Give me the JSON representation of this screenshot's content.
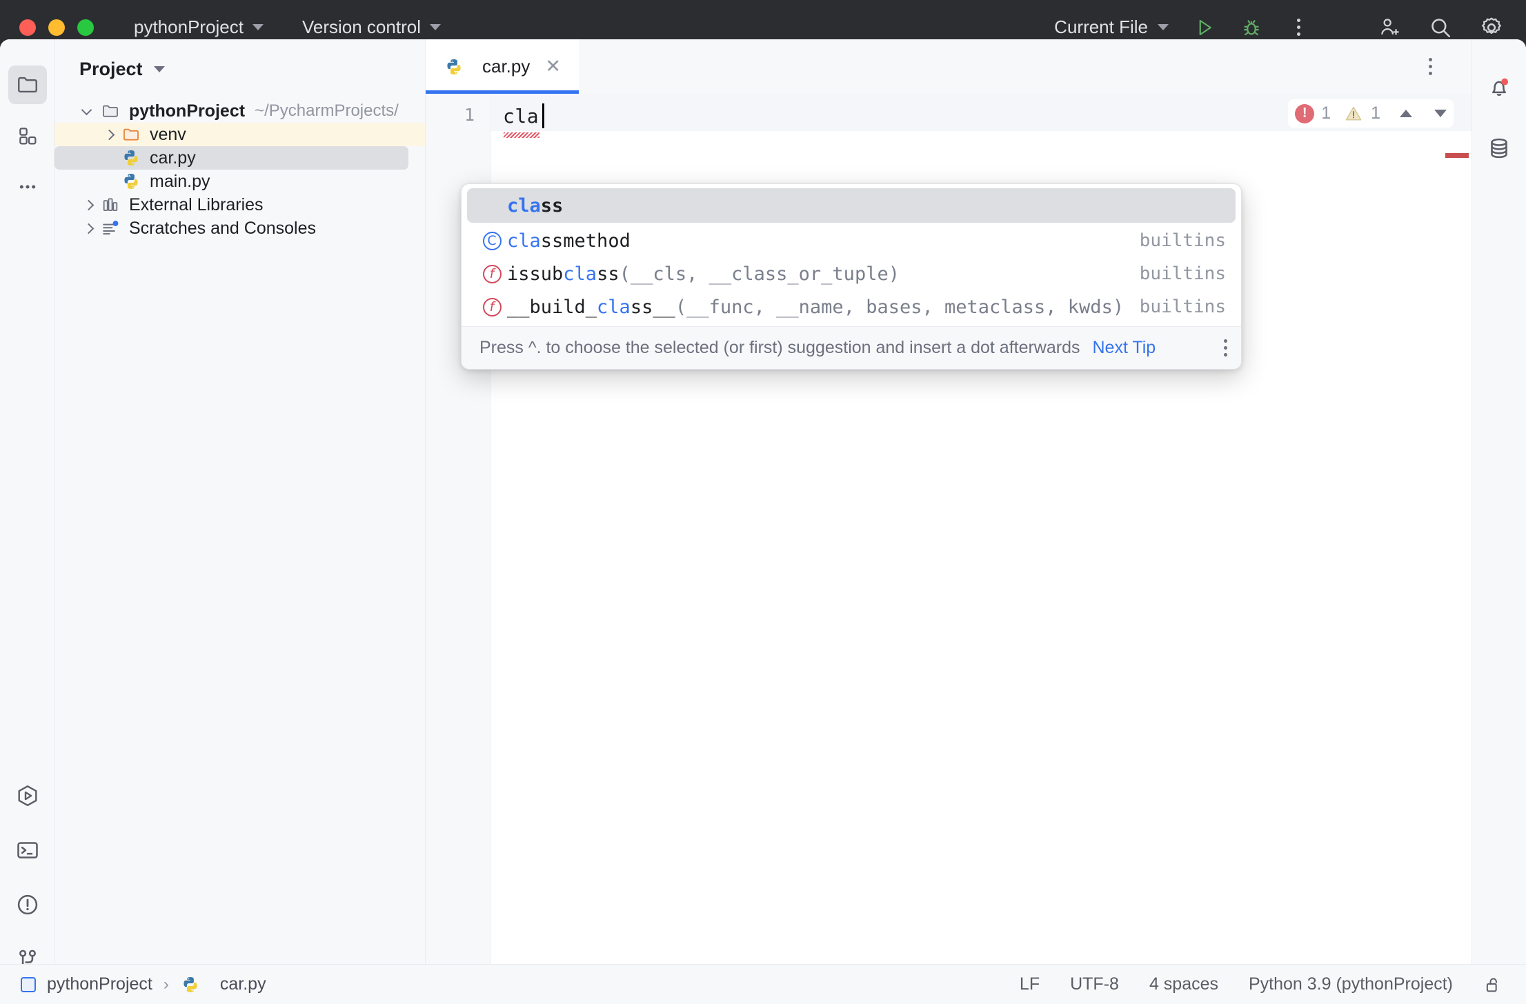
{
  "titlebar": {
    "project_name": "pythonProject",
    "version_control": "Version control",
    "run_config": "Current File",
    "run_icon": "run-triangle-icon",
    "debug_icon": "debug-bug-icon",
    "more_icon": "more-vertical-icon",
    "account_icon": "add-user-icon",
    "search_icon": "search-icon",
    "settings_icon": "gear-icon"
  },
  "left_rail": {
    "top": [
      {
        "name": "project-tool-icon",
        "label": "Project",
        "active": true
      },
      {
        "name": "structure-tool-icon",
        "label": "Structure",
        "active": false
      },
      {
        "name": "more-tools-icon",
        "label": "More tools",
        "active": false
      }
    ],
    "bottom": [
      {
        "name": "run-tool-icon",
        "label": "Run"
      },
      {
        "name": "terminal-tool-icon",
        "label": "Terminal"
      },
      {
        "name": "problems-tool-icon",
        "label": "Problems"
      },
      {
        "name": "version-control-tool-icon",
        "label": "Version Control"
      }
    ]
  },
  "right_rail": {
    "items": [
      {
        "name": "notifications-bell-icon",
        "label": "Notifications",
        "badge": true
      },
      {
        "name": "database-icon",
        "label": "Database",
        "badge": false
      }
    ]
  },
  "project_panel": {
    "title": "Project",
    "tree": [
      {
        "label": "pythonProject",
        "path": "~/PycharmProjects/",
        "icon": "folder-icon",
        "arrow": "down",
        "indent": 1,
        "bold": true,
        "state": "none"
      },
      {
        "label": "venv",
        "path": "",
        "icon": "folder-orange-icon",
        "arrow": "right",
        "indent": 2,
        "bold": false,
        "state": "highlight"
      },
      {
        "label": "car.py",
        "path": "",
        "icon": "python-file-icon",
        "arrow": "none",
        "indent": 3,
        "bold": false,
        "state": "selected"
      },
      {
        "label": "main.py",
        "path": "",
        "icon": "python-file-icon",
        "arrow": "none",
        "indent": 3,
        "bold": false,
        "state": "none"
      },
      {
        "label": "External Libraries",
        "path": "",
        "icon": "library-icon",
        "arrow": "right",
        "indent": 1,
        "bold": false,
        "state": "none"
      },
      {
        "label": "Scratches and Consoles",
        "path": "",
        "icon": "scratches-icon",
        "arrow": "right",
        "indent": 1,
        "bold": false,
        "state": "none"
      }
    ]
  },
  "editor": {
    "tab": {
      "label": "car.py",
      "icon": "python-file-icon",
      "close_icon": "close-icon"
    },
    "options_icon": "more-vertical-icon",
    "line_number": "1",
    "code_text": "cla",
    "inspection": {
      "error_icon": "error-circle-icon",
      "error_count": "1",
      "warning_icon": "warning-triangle-icon",
      "warning_count": "1",
      "prev_icon": "chevron-up-icon",
      "next_icon": "chevron-down-icon"
    }
  },
  "completion_popup": {
    "items": [
      {
        "icon": "none",
        "match": "cla",
        "rest": "ss",
        "rest_class": "kw",
        "args": "",
        "source": "",
        "selected": true,
        "name": "completion-item-class"
      },
      {
        "icon": "class-icon",
        "match": "cla",
        "rest": "ssmethod",
        "rest_class": "",
        "args": "",
        "source": "builtins",
        "selected": false,
        "name": "completion-item-classmethod"
      },
      {
        "icon": "function-icon",
        "prefix": "issub",
        "match": "cla",
        "rest": "ss",
        "rest_class": "",
        "args": "(__cls, __class_or_tuple)",
        "source": "builtins",
        "selected": false,
        "name": "completion-item-issubclass"
      },
      {
        "icon": "function-icon",
        "prefix": "__build_",
        "match": "cla",
        "rest": "ss__",
        "rest_class": "",
        "args": "(__func, __name, bases, metaclass, kwds)",
        "source": "builtins",
        "selected": false,
        "name": "completion-item-build-class"
      }
    ],
    "hint": {
      "text": "Press ^. to choose the selected (or first) suggestion and insert a dot afterwards",
      "link": "Next Tip",
      "kebab_icon": "more-vertical-icon"
    }
  },
  "status_bar": {
    "breadcrumb": [
      {
        "label": "pythonProject",
        "icon": "project-square-icon"
      },
      {
        "label": "car.py",
        "icon": "python-file-icon"
      }
    ],
    "separator": "›",
    "line_separator": "LF",
    "encoding": "UTF-8",
    "indent": "4 spaces",
    "interpreter": "Python 3.9 (pythonProject)",
    "lock_icon": "unlocked-icon"
  },
  "colors": {
    "titlebar_bg": "#2b2d30",
    "panel_bg": "#f7f8fa",
    "editor_bg": "#ffffff",
    "accent_blue": "#3574f0",
    "selection_gray": "#dcdee2",
    "highlight_yellow": "#fdf6e3",
    "error_red": "#e06b74",
    "warning_yellow": "#e8d69a",
    "run_green": "#5fad65"
  }
}
